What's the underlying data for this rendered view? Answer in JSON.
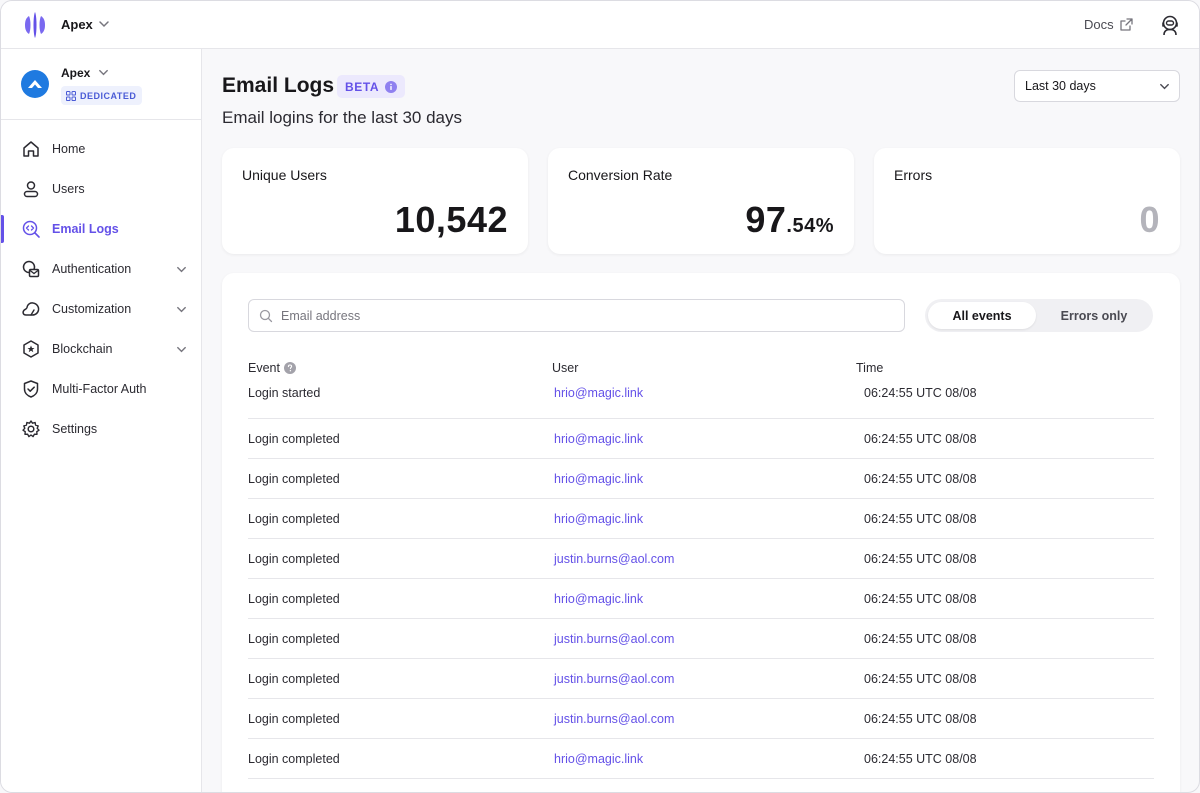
{
  "topbar": {
    "app_name": "Apex",
    "docs_label": "Docs"
  },
  "sidebar": {
    "project_name": "Apex",
    "project_badge": "DEDICATED",
    "items": [
      {
        "label": "Home",
        "icon": "home-icon",
        "active": false,
        "expandable": false
      },
      {
        "label": "Users",
        "icon": "user-icon",
        "active": false,
        "expandable": false
      },
      {
        "label": "Email Logs",
        "icon": "email-logs-icon",
        "active": true,
        "expandable": false
      },
      {
        "label": "Authentication",
        "icon": "authentication-icon",
        "active": false,
        "expandable": true
      },
      {
        "label": "Customization",
        "icon": "customization-icon",
        "active": false,
        "expandable": true
      },
      {
        "label": "Blockchain",
        "icon": "blockchain-icon",
        "active": false,
        "expandable": true
      },
      {
        "label": "Multi-Factor Auth",
        "icon": "shield-check-icon",
        "active": false,
        "expandable": false
      },
      {
        "label": "Settings",
        "icon": "gear-icon",
        "active": false,
        "expandable": false
      }
    ]
  },
  "header": {
    "title": "Email Logs",
    "badge": "BETA",
    "subtitle": "Email logins for the last 30 days",
    "range_select": "Last 30 days"
  },
  "stats": {
    "unique_users": {
      "label": "Unique Users",
      "value": "10,542"
    },
    "conversion_rate": {
      "label": "Conversion Rate",
      "value_main": "97",
      "value_fraction": ".54%"
    },
    "errors": {
      "label": "Errors",
      "value": "0"
    }
  },
  "filters": {
    "search_placeholder": "Email address",
    "search_value": "",
    "segment": [
      "All events",
      "Errors only"
    ],
    "segment_selected": "All events"
  },
  "table": {
    "columns": [
      "Event",
      "User",
      "Time"
    ],
    "rows": [
      {
        "event": "Login started",
        "user": "hrio@magic.link",
        "time": "06:24:55 UTC 08/08"
      },
      {
        "event": "Login completed",
        "user": "hrio@magic.link",
        "time": "06:24:55 UTC 08/08"
      },
      {
        "event": "Login completed",
        "user": "hrio@magic.link",
        "time": "06:24:55 UTC 08/08"
      },
      {
        "event": "Login completed",
        "user": "hrio@magic.link",
        "time": "06:24:55 UTC 08/08"
      },
      {
        "event": "Login completed",
        "user": "justin.burns@aol.com",
        "time": "06:24:55 UTC 08/08"
      },
      {
        "event": "Login completed",
        "user": "hrio@magic.link",
        "time": "06:24:55 UTC 08/08"
      },
      {
        "event": "Login completed",
        "user": "justin.burns@aol.com",
        "time": "06:24:55 UTC 08/08"
      },
      {
        "event": "Login completed",
        "user": "justin.burns@aol.com",
        "time": "06:24:55 UTC 08/08"
      },
      {
        "event": "Login completed",
        "user": "justin.burns@aol.com",
        "time": "06:24:55 UTC 08/08"
      },
      {
        "event": "Login completed",
        "user": "hrio@magic.link",
        "time": "06:24:55 UTC 08/08"
      }
    ]
  },
  "colors": {
    "accent": "#6451e8",
    "project_avatar": "#1f7ae0",
    "muted_value": "#b4b4bb"
  }
}
